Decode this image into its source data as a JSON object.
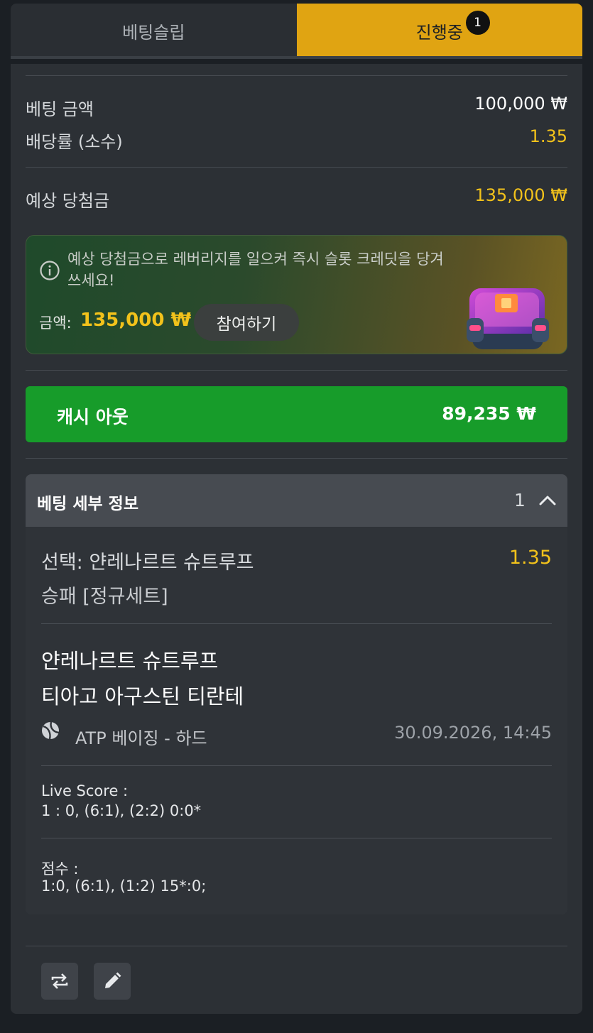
{
  "tabs": {
    "betslip_label": "베팅슬립",
    "active_label": "진행중",
    "active_badge": "1"
  },
  "summary": {
    "stake_label": "베팅 금액",
    "stake_value": "100,000 ₩",
    "odds_label": "배당률 (소수)",
    "odds_value": "1.35",
    "payout_label": "예상 당첨금",
    "payout_value": "135,000 ₩"
  },
  "promo": {
    "message": "예상 당첨금으로 레버리지를 일으켜 즉시 슬롯 크레딧을 당겨 쓰세요!",
    "amount_label": "금액:",
    "amount_value": "135,000 ₩",
    "join_label": "참여하기",
    "icon": "info-icon"
  },
  "cashout": {
    "label": "캐시 아웃",
    "value": "89,235 ₩"
  },
  "details": {
    "title": "베팅 세부 정보",
    "count": "1",
    "selection": "선택: 얀레나르트 슈트루프",
    "market": "승패 [정규세트]",
    "odds": "1.35",
    "team_home": "얀레나르트 슈트루프",
    "team_away": "티아고 아구스틴 티란테",
    "league": "ATP 베이징 - 하드",
    "datetime": "30.09.2026, 14:45",
    "live_score_label": "Live Score :",
    "live_score_value": "1 : 0, (6:1), (2:2) 0:0*",
    "score_label": "점수 :",
    "score_value": "1:0, (6:1), (1:2) 15*:0;"
  },
  "colors": {
    "accent": "#e0a412",
    "odds": "#f2c21b",
    "cashout": "#179c2a",
    "panel": "#2c3035"
  }
}
